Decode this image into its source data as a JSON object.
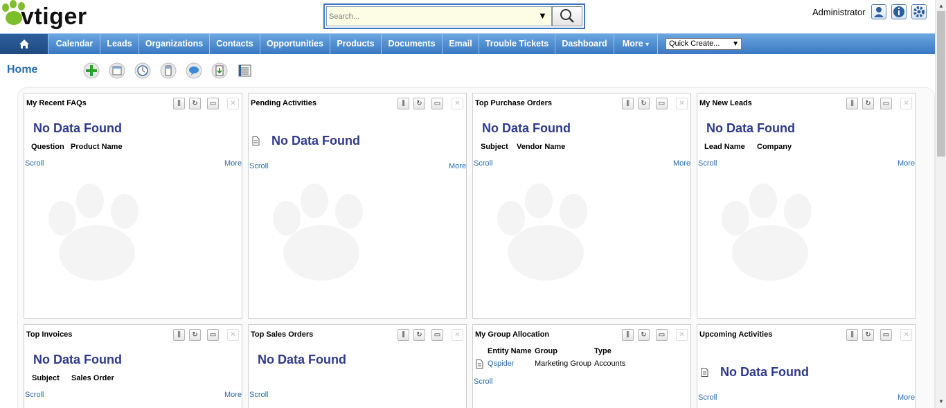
{
  "brand": {
    "name": "vtiger"
  },
  "search": {
    "placeholder": "Search..."
  },
  "header": {
    "user": "Administrator",
    "icons": [
      "my-preferences-icon",
      "info-icon",
      "settings-gear-icon"
    ]
  },
  "nav": {
    "items": [
      "Calendar",
      "Leads",
      "Organizations",
      "Contacts",
      "Opportunities",
      "Products",
      "Documents",
      "Email",
      "Trouble Tickets",
      "Dashboard",
      "More"
    ],
    "more_arrow": "▾",
    "quick_create": "Quick Create...",
    "colors": {
      "bar_top": "#6aa6e0",
      "bar_bottom": "#3a78c3",
      "home_bg": "#1e4a80"
    }
  },
  "page": {
    "title": "Home"
  },
  "toolbar_icons": [
    "add-widget-icon",
    "layout-icon",
    "clock-icon",
    "calculator-icon",
    "chat-icon",
    "import-icon",
    "notebook-icon"
  ],
  "widget_common": {
    "no_data": "No Data Found",
    "scroll": "Scroll",
    "more": "More",
    "no_data_color": "#2f3a8c"
  },
  "widgets": [
    {
      "title": "My Recent FAQs",
      "columns": [
        "Question",
        "Product Name"
      ]
    },
    {
      "title": "Pending Activities",
      "columns": []
    },
    {
      "title": "Top Purchase Orders",
      "columns": [
        "Subject",
        "Vendor Name"
      ]
    },
    {
      "title": "My New Leads",
      "columns": [
        "Lead Name",
        "Company"
      ]
    },
    {
      "title": "Top Invoices",
      "columns": [
        "Subject",
        "Sales Order"
      ]
    },
    {
      "title": "Top Sales Orders",
      "columns": []
    },
    {
      "title": "My Group Allocation",
      "columns": [
        "Entity Name",
        "Group",
        "Type"
      ],
      "rows": [
        {
          "entity": "Qspider",
          "group": "Marketing Group",
          "type": "Accounts"
        }
      ]
    },
    {
      "title": "Upcoming Activities",
      "columns": []
    }
  ]
}
